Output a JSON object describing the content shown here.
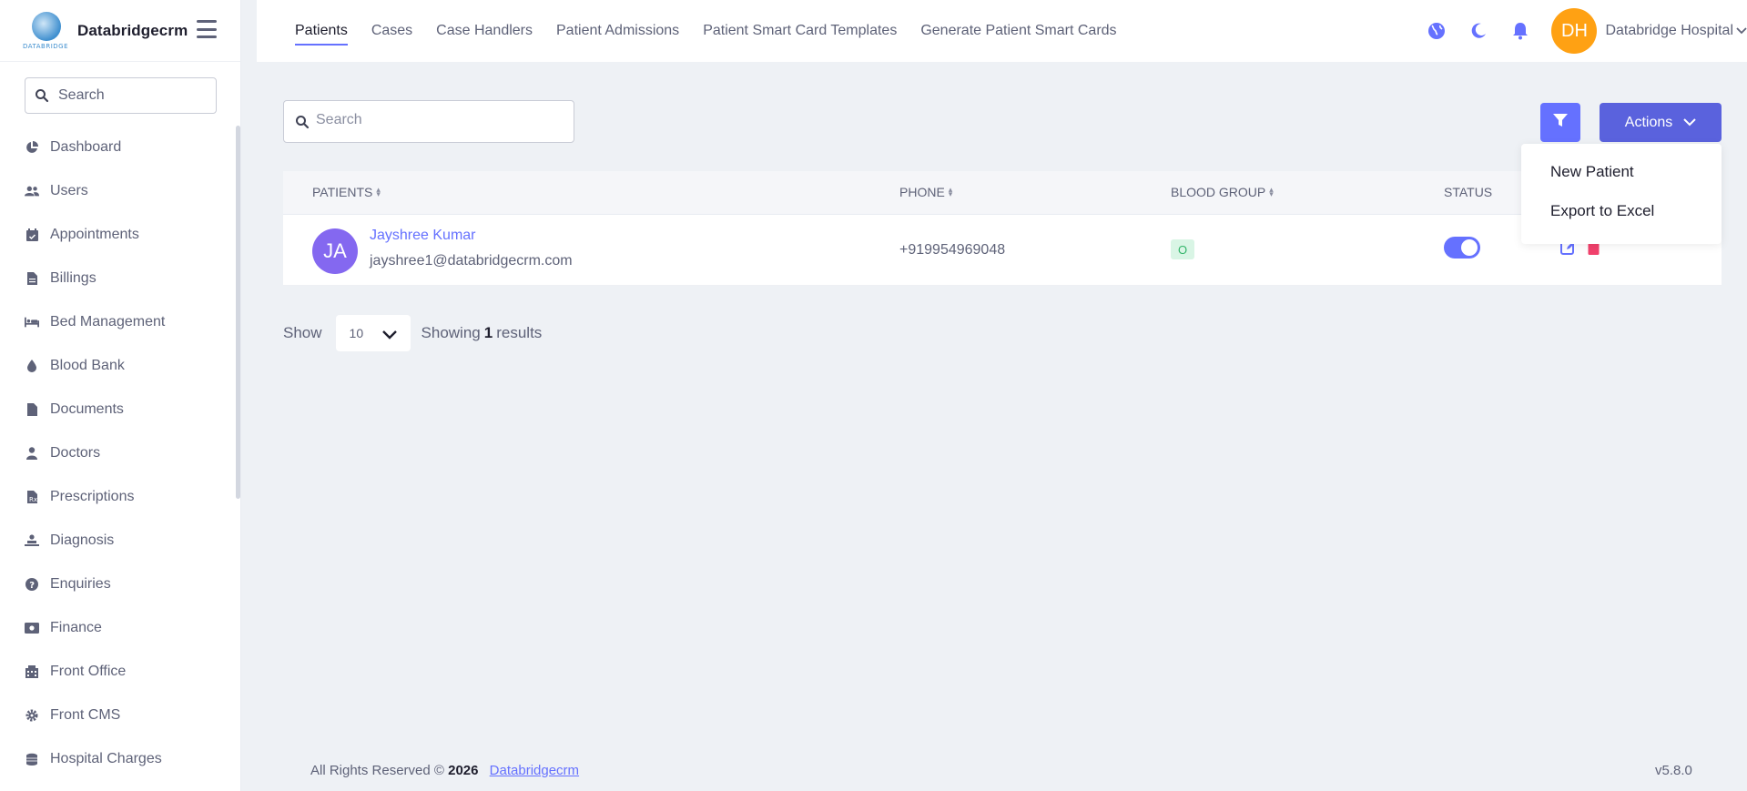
{
  "brand": {
    "name": "Databridgecrm",
    "logo_caption": "DATABRIDGE"
  },
  "sidebar": {
    "search_placeholder": "Search",
    "items": [
      {
        "label": "Dashboard",
        "icon": "pie-chart-icon"
      },
      {
        "label": "Users",
        "icon": "users-icon"
      },
      {
        "label": "Appointments",
        "icon": "calendar-check-icon"
      },
      {
        "label": "Billings",
        "icon": "invoice-icon"
      },
      {
        "label": "Bed Management",
        "icon": "bed-icon"
      },
      {
        "label": "Blood Bank",
        "icon": "droplet-icon"
      },
      {
        "label": "Documents",
        "icon": "file-icon"
      },
      {
        "label": "Doctors",
        "icon": "doctor-icon"
      },
      {
        "label": "Prescriptions",
        "icon": "prescription-icon"
      },
      {
        "label": "Diagnosis",
        "icon": "diagnosis-icon"
      },
      {
        "label": "Enquiries",
        "icon": "question-circle-icon"
      },
      {
        "label": "Finance",
        "icon": "money-icon"
      },
      {
        "label": "Front Office",
        "icon": "building-icon"
      },
      {
        "label": "Front CMS",
        "icon": "gear-icon"
      },
      {
        "label": "Hospital Charges",
        "icon": "coins-icon"
      }
    ]
  },
  "header": {
    "tabs": [
      {
        "label": "Patients",
        "active": true
      },
      {
        "label": "Cases"
      },
      {
        "label": "Case Handlers"
      },
      {
        "label": "Patient Admissions"
      },
      {
        "label": "Patient Smart Card Templates"
      },
      {
        "label": "Generate Patient Smart Cards"
      }
    ],
    "user_initials": "DH",
    "user_name": "Databridge Hospital"
  },
  "main": {
    "search_placeholder": "Search",
    "actions_label": "Actions",
    "dropdown": [
      "New Patient",
      "Export to Excel"
    ],
    "columns": {
      "patients": "PATIENTS",
      "phone": "PHONE",
      "blood_group": "BLOOD GROUP",
      "status": "STATUS"
    },
    "rows": [
      {
        "initials": "JA",
        "name": "Jayshree Kumar",
        "email": "jayshree1@databridgecrm.com",
        "phone": "+919954969048",
        "blood_group": "O",
        "status": true
      }
    ],
    "pager": {
      "show_label": "Show",
      "page_size": "10",
      "showing_prefix": "Showing",
      "count": "1",
      "showing_suffix": "results"
    }
  },
  "footer": {
    "text": "All Rights Reserved ©",
    "year": "2026",
    "link": "Databridgecrm",
    "version": "v5.8.0"
  },
  "colors": {
    "accent": "#6571ff",
    "avatar_orange": "#ffa113",
    "avatar_purple": "#8468f0",
    "danger": "#f1416c"
  }
}
